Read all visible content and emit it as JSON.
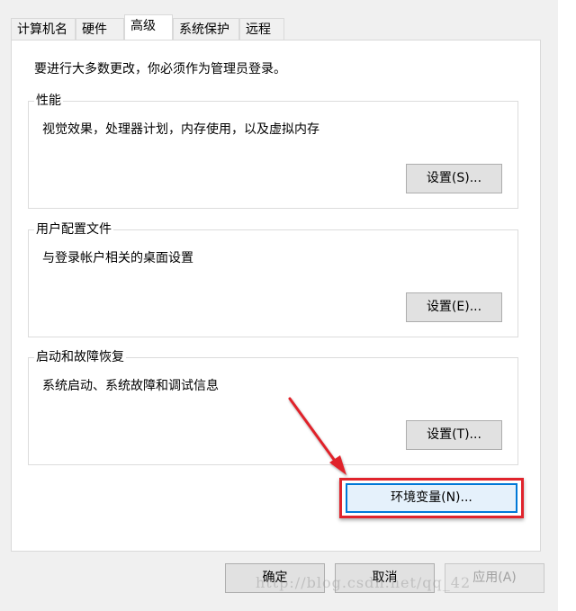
{
  "tabs": [
    {
      "label": "计算机名"
    },
    {
      "label": "硬件"
    },
    {
      "label": "高级"
    },
    {
      "label": "系统保护"
    },
    {
      "label": "远程"
    }
  ],
  "active_tab": "高级",
  "intro": "要进行大多数更改，你必须作为管理员登录。",
  "performance": {
    "title": "性能",
    "description": "视觉效果，处理器计划，内存使用，以及虚拟内存",
    "button": "设置(S)..."
  },
  "user_profiles": {
    "title": "用户配置文件",
    "description": "与登录帐户相关的桌面设置",
    "button": "设置(E)..."
  },
  "startup_recovery": {
    "title": "启动和故障恢复",
    "description": "系统启动、系统故障和调试信息",
    "button": "设置(T)..."
  },
  "env_button": "环境变量(N)...",
  "footer": {
    "ok": "确定",
    "cancel": "取消",
    "apply": "应用(A)"
  },
  "watermark": "http://blog.csdn.net/qq_42",
  "colors": {
    "highlight": "#e0242c",
    "focus": "#0078d7"
  }
}
